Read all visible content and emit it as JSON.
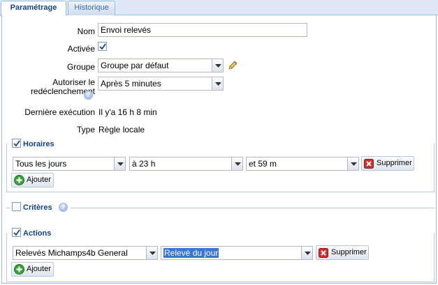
{
  "tabs": [
    {
      "label": "Paramétrage",
      "active": true
    },
    {
      "label": "Historique",
      "active": false
    }
  ],
  "form": {
    "nom_label": "Nom",
    "nom_value": "Envoi relevés",
    "activee_label": "Activée",
    "activee_checked": true,
    "groupe_label": "Groupe",
    "groupe_value": "Groupe par défaut",
    "autoriser_label_line1": "Autoriser le",
    "autoriser_label_line2": "redéclenchement",
    "autoriser_value": "Après 5 minutes",
    "derniere_label": "Dernière exécution",
    "derniere_value": "Il y'a 16 h 8 min",
    "type_label": "Type",
    "type_value": "Règle locale"
  },
  "horaires": {
    "legend": "Horaires",
    "checked": true,
    "day_value": "Tous les jours",
    "hour_value": "à 23 h",
    "minute_value": "et 59 m",
    "delete_label": "Supprimer",
    "add_label": "Ajouter"
  },
  "criteres": {
    "legend": "Critères",
    "checked": false
  },
  "actions": {
    "legend": "Actions",
    "checked": true,
    "action_value": "Relevés Michamps4b General",
    "report_value": "Relevé du jour",
    "delete_label": "Supprimer",
    "add_label": "Ajouter"
  },
  "colors": {
    "accent": "#15428b",
    "border": "#99bbe8",
    "selection": "#3875d7"
  }
}
